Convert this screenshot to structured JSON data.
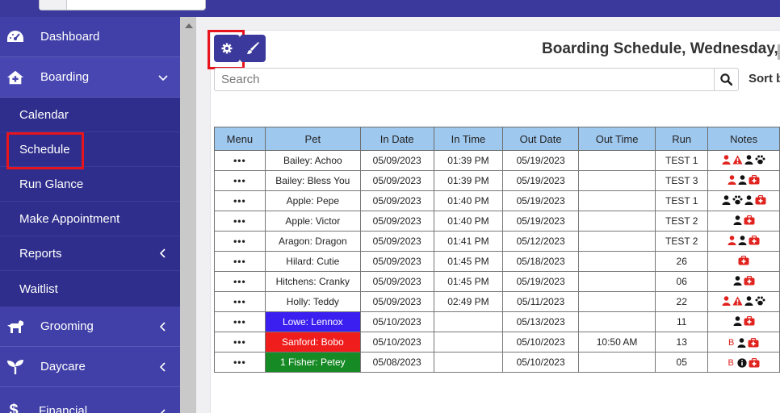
{
  "sidebar": {
    "items": [
      {
        "label": "Dashboard"
      },
      {
        "label": "Boarding"
      },
      {
        "label": "Grooming"
      },
      {
        "label": "Daycare"
      },
      {
        "label": "Financial"
      }
    ],
    "boarding_sub": [
      {
        "label": "Calendar"
      },
      {
        "label": "Schedule"
      },
      {
        "label": "Run Glance"
      },
      {
        "label": "Make Appointment"
      },
      {
        "label": "Reports"
      },
      {
        "label": "Waitlist"
      }
    ]
  },
  "main": {
    "title": "Boarding Schedule, Wednesday, I",
    "search_placeholder": "Search",
    "sort_label": "Sort b"
  },
  "colors": {
    "accent": "#3b3a9c",
    "header": "#9fc8ee",
    "alert": "#e0231e"
  },
  "table": {
    "columns": [
      "Menu",
      "Pet",
      "In Date",
      "In Time",
      "Out Date",
      "Out Time",
      "Run",
      "Notes"
    ],
    "rows": [
      {
        "menu": "•••",
        "pet": "Bailey: Achoo",
        "in_date": "05/09/2023",
        "in_time": "01:39 PM",
        "out_date": "05/19/2023",
        "out_time": "",
        "run": "TEST 1",
        "notes": [
          "person-red",
          "warning",
          "person",
          "paw"
        ]
      },
      {
        "menu": "•••",
        "pet": "Bailey: Bless You",
        "in_date": "05/09/2023",
        "in_time": "01:39 PM",
        "out_date": "05/19/2023",
        "out_time": "",
        "run": "TEST 3",
        "notes": [
          "person-red",
          "person",
          "medkit"
        ]
      },
      {
        "menu": "•••",
        "pet": "Apple: Pepe",
        "in_date": "05/09/2023",
        "in_time": "01:40 PM",
        "out_date": "05/19/2023",
        "out_time": "",
        "run": "TEST 1",
        "notes": [
          "person",
          "paw",
          "person",
          "medkit"
        ]
      },
      {
        "menu": "•••",
        "pet": "Apple: Victor",
        "in_date": "05/09/2023",
        "in_time": "01:40 PM",
        "out_date": "05/19/2023",
        "out_time": "",
        "run": "TEST 2",
        "notes": [
          "person",
          "medkit"
        ]
      },
      {
        "menu": "•••",
        "pet": "Aragon: Dragon",
        "in_date": "05/09/2023",
        "in_time": "01:41 PM",
        "out_date": "05/12/2023",
        "out_time": "",
        "run": "TEST 2",
        "notes": [
          "person-red",
          "person",
          "medkit"
        ]
      },
      {
        "menu": "•••",
        "pet": "Hilard: Cutie",
        "in_date": "05/09/2023",
        "in_time": "01:45 PM",
        "out_date": "05/18/2023",
        "out_time": "",
        "run": "26",
        "notes": [
          "medkit"
        ]
      },
      {
        "menu": "•••",
        "pet": "Hitchens: Cranky",
        "in_date": "05/09/2023",
        "in_time": "01:45 PM",
        "out_date": "05/19/2023",
        "out_time": "",
        "run": "06",
        "notes": [
          "person",
          "medkit"
        ]
      },
      {
        "menu": "•••",
        "pet": "Holly: Teddy",
        "in_date": "05/09/2023",
        "in_time": "02:49 PM",
        "out_date": "05/11/2023",
        "out_time": "",
        "run": "22",
        "notes": [
          "person-red",
          "warning",
          "person",
          "paw"
        ]
      },
      {
        "menu": "•••",
        "pet": "Lowe: Lennox",
        "in_date": "05/10/2023",
        "in_time": "",
        "out_date": "05/13/2023",
        "out_time": "",
        "run": "11",
        "notes": [
          "person",
          "medkit"
        ],
        "pet_bg": "#3a1ff0",
        "pet_fg": "#ffffff"
      },
      {
        "menu": "•••",
        "pet": "Sanford: Bobo",
        "in_date": "05/10/2023",
        "in_time": "",
        "out_date": "05/10/2023",
        "out_time": "10:50 AM",
        "run": "13",
        "notes": [
          "B",
          "person",
          "medkit"
        ],
        "pet_bg": "#f01d1d",
        "pet_fg": "#ffffff"
      },
      {
        "menu": "•••",
        "pet": "1 Fisher: Petey",
        "in_date": "05/08/2023",
        "in_time": "",
        "out_date": "05/10/2023",
        "out_time": "",
        "run": "05",
        "notes": [
          "B",
          "info",
          "medkit"
        ],
        "pet_bg": "#168a24",
        "pet_fg": "#ffffff"
      }
    ]
  }
}
